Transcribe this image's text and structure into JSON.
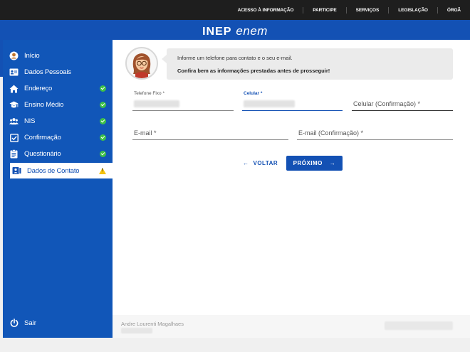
{
  "topnav": {
    "items": [
      "ACESSO À INFORMAÇÃO",
      "PARTICIPE",
      "SERVIÇOS",
      "LEGISLAÇÃO",
      "ÓRGÃ"
    ]
  },
  "brand": {
    "inep": "INEP",
    "enem": "enem"
  },
  "sidebar": {
    "items": [
      {
        "label": "Início",
        "icon": "user-circle-icon",
        "status": ""
      },
      {
        "label": "Dados Pessoais",
        "icon": "id-card-icon",
        "status": ""
      },
      {
        "label": "Endereço",
        "icon": "home-icon",
        "status": "check"
      },
      {
        "label": "Ensino Médio",
        "icon": "graduation-cap-icon",
        "status": "check"
      },
      {
        "label": "NIS",
        "icon": "users-icon",
        "status": "check"
      },
      {
        "label": "Confirmação",
        "icon": "checkbox-icon",
        "status": "check"
      },
      {
        "label": "Questionário",
        "icon": "clipboard-icon",
        "status": "check"
      },
      {
        "label": "Dados de Contato",
        "icon": "contact-icon",
        "status": "warning"
      }
    ],
    "logout_label": "Sair"
  },
  "message": {
    "line1": "Informe um telefone para contato e o seu e-mail.",
    "line2": "Confira bem as informações prestadas antes de prosseguir!"
  },
  "form": {
    "telefone_label": "Telefone Fixo *",
    "celular_label": "Celular *",
    "celular_confirm_placeholder": "Celular (Confirmação) *",
    "email_placeholder": "E-mail *",
    "email_confirm_placeholder": "E-mail (Confirmação) *"
  },
  "buttons": {
    "back": "VOLTAR",
    "next": "PRÓXIMO"
  },
  "footer": {
    "user_name": "Andre Lourenti Magalhaes"
  },
  "colors": {
    "primary": "#1351b4",
    "check": "#3ec048",
    "warning": "#f4c20d"
  }
}
